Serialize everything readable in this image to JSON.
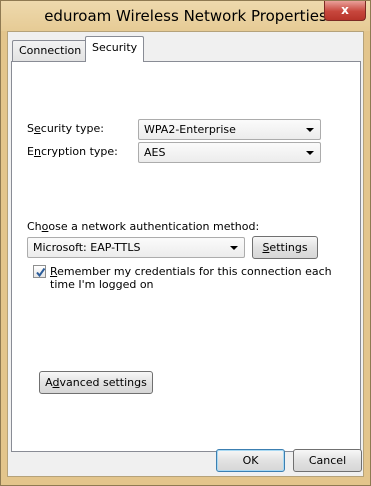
{
  "window": {
    "title": "eduroam Wireless Network Properties",
    "close_glyph": "x"
  },
  "tabs": [
    {
      "label": "Connection",
      "selected": false
    },
    {
      "label": "Security",
      "selected": true
    }
  ],
  "security": {
    "security_type": {
      "label_prefix": "S",
      "label_mnemonic": "e",
      "label_rest": "curity type:",
      "value": "WPA2-Enterprise"
    },
    "encryption_type": {
      "label_prefix": "E",
      "label_mnemonic": "n",
      "label_rest": "cryption type:",
      "value": "AES"
    },
    "auth_method": {
      "label_prefix": "Ch",
      "label_mnemonic": "o",
      "label_rest": "ose a network authentication method:",
      "value": "Microsoft: EAP-TTLS"
    },
    "settings_button": {
      "mnemonic": "S",
      "rest": "ettings"
    },
    "remember": {
      "checked": true,
      "mnemonic": "R",
      "line1_rest": "emember my credentials for this connection each",
      "line2": "time I'm logged on"
    },
    "advanced_button": {
      "prefix": "A",
      "mnemonic": "d",
      "rest": "vanced settings"
    }
  },
  "footer": {
    "ok_label": "OK",
    "cancel_label": "Cancel"
  },
  "colors": {
    "frame": "#e3c58c",
    "close": "#c7463c",
    "default_button_border": "#3c7fb1"
  }
}
